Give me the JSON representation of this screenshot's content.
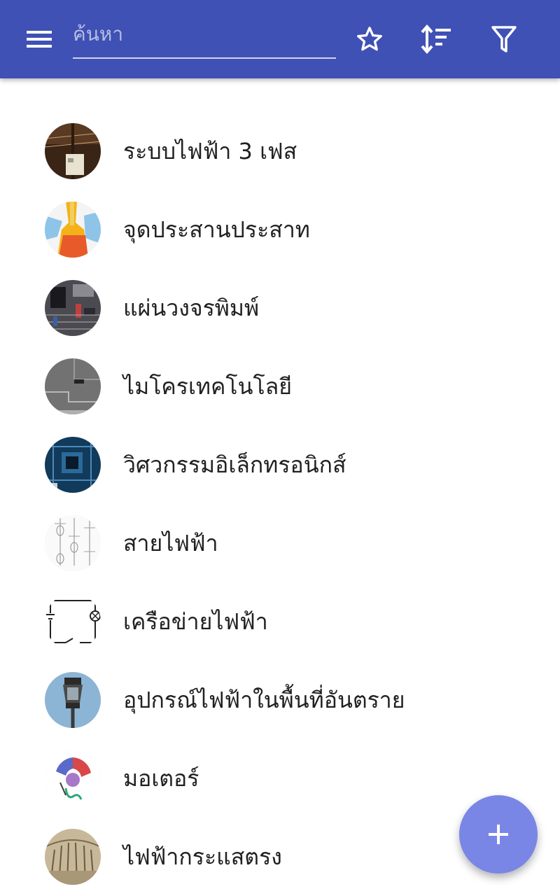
{
  "toolbar": {
    "background_color": "#3f51b5",
    "menu_icon": "hamburger-menu-icon",
    "search": {
      "placeholder": "ค้นหา",
      "value": ""
    },
    "actions": [
      {
        "icon": "star-outline-icon"
      },
      {
        "icon": "sort-icon"
      },
      {
        "icon": "filter-icon"
      }
    ]
  },
  "list": {
    "items": [
      {
        "label": "ระบบไฟฟ้า 3 เฟส",
        "thumbnail": "utility-pole-photo"
      },
      {
        "label": "จุดประสานประสาท",
        "thumbnail": "synapse-diagram"
      },
      {
        "label": "แผ่นวงจรพิมพ์",
        "thumbnail": "circuit-board-photo"
      },
      {
        "label": "ไมโครเทคโนโลยี",
        "thumbnail": "microchip-photo"
      },
      {
        "label": "วิศวกรรมอิเล็กทรอนิกส์",
        "thumbnail": "motherboard-photo"
      },
      {
        "label": "สายไฟฟ้า",
        "thumbnail": "cable-diagram"
      },
      {
        "label": "เครือข่ายไฟฟ้า",
        "thumbnail": "circuit-schematic"
      },
      {
        "label": "อุปกรณ์ไฟฟ้าในพื้นที่อันตราย",
        "thumbnail": "explosion-proof-lamp-photo"
      },
      {
        "label": "มอเตอร์",
        "thumbnail": "motor-diagram"
      },
      {
        "label": "ไฟฟ้ากระแสตรง",
        "thumbnail": "vintage-engraving"
      }
    ]
  },
  "fab": {
    "icon": "plus-icon",
    "color": "#7986e6"
  }
}
